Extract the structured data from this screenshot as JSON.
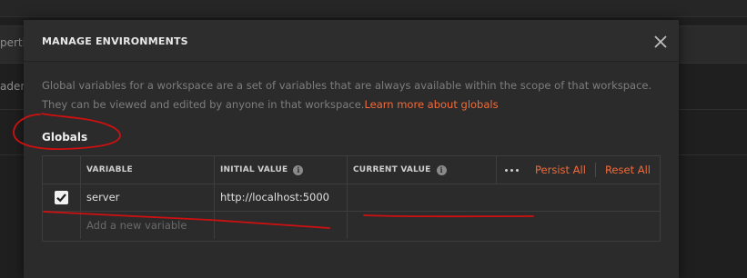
{
  "background": {
    "fragment_1": "perti",
    "fragment_2": "aders"
  },
  "modal": {
    "title": "MANAGE ENVIRONMENTS",
    "description": "Global variables for a workspace are a set of variables that are always available within the scope of that workspace. They can be viewed and edited by anyone in that workspace.",
    "learn_more_link": "Learn more about globals",
    "section_title": "Globals"
  },
  "table": {
    "headers": {
      "variable": "VARIABLE",
      "initial_value": "INITIAL VALUE",
      "current_value": "CURRENT VALUE"
    },
    "actions": {
      "persist_all": "Persist All",
      "reset_all": "Reset All"
    },
    "rows": [
      {
        "checked": true,
        "variable": "server",
        "initial_value": "http://localhost:5000",
        "current_value": ""
      }
    ],
    "new_variable_placeholder": "Add a new variable"
  },
  "colors": {
    "accent": "#f26b3a",
    "annotation": "#d01010",
    "modal_bg": "#2b2b2b"
  },
  "icons": [
    "close-icon",
    "info-icon",
    "more-options-icon",
    "checkmark-icon"
  ]
}
